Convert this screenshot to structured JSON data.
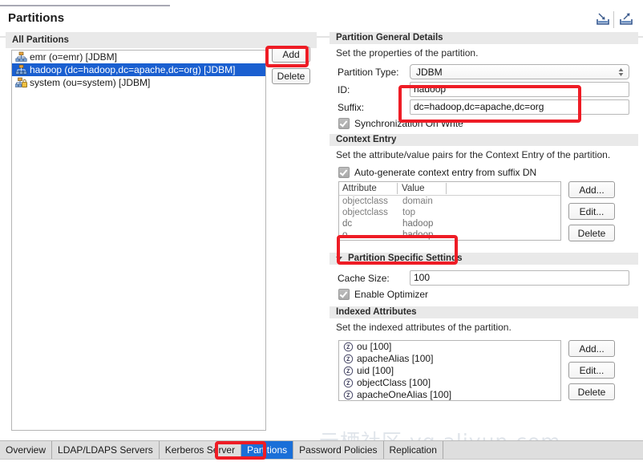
{
  "window": {
    "title": "Partitions",
    "restore_icon": "restore-window-icon",
    "maximize_icon": "maximize-window-icon"
  },
  "left": {
    "section_title": "All Partitions",
    "partitions": [
      {
        "icon": "partition-tree-icon",
        "label": "emr (o=emr) [JDBM]",
        "selected": false
      },
      {
        "icon": "partition-tree-icon",
        "label": "hadoop (dc=hadoop,dc=apache,dc=org) [JDBM]",
        "selected": true
      },
      {
        "icon": "partition-tree-locked-icon",
        "label": "system (ou=system) [JDBM]",
        "selected": false
      }
    ],
    "add_label": "Add",
    "delete_label": "Delete"
  },
  "general": {
    "header": "Partition General Details",
    "description": "Set the properties of the partition.",
    "partition_type_label": "Partition Type:",
    "partition_type_value": "JDBM",
    "partition_type_options": [
      "JDBM"
    ],
    "id_label": "ID:",
    "id_value": "hadoop",
    "id_placeholder": "",
    "suffix_label": "Suffix:",
    "suffix_value": "dc=hadoop,dc=apache,dc=org",
    "suffix_placeholder": "",
    "sync_on_write_label": "Synchronization On Write",
    "sync_on_write_checked": true
  },
  "context_entry": {
    "header": "Context Entry",
    "description": "Set the attribute/value pairs for the Context Entry of the partition.",
    "autogen_label": "Auto-generate context entry from suffix DN",
    "autogen_checked": true,
    "columns": [
      "Attribute",
      "Value"
    ],
    "rows": [
      {
        "attribute": "objectclass",
        "value": "domain"
      },
      {
        "attribute": "objectclass",
        "value": "top"
      },
      {
        "attribute": "dc",
        "value": "hadoop"
      },
      {
        "attribute": "o",
        "value": "hadoop"
      }
    ],
    "add_label": "Add...",
    "edit_label": "Edit...",
    "delete_label": "Delete"
  },
  "specific": {
    "header": "Partition Specific Settings",
    "expanded": true,
    "cache_size_label": "Cache Size:",
    "cache_size_value": "100",
    "enable_optimizer_label": "Enable Optimizer",
    "enable_optimizer_checked": true
  },
  "indexed": {
    "header": "Indexed Attributes",
    "description": "Set the indexed attributes of the partition.",
    "items": [
      "ou [100]",
      "apacheAlias [100]",
      "uid [100]",
      "objectClass [100]",
      "apacheOneAlias [100]"
    ],
    "add_label": "Add...",
    "edit_label": "Edit...",
    "delete_label": "Delete"
  },
  "tabs": [
    {
      "label": "Overview",
      "active": false
    },
    {
      "label": "LDAP/LDAPS Servers",
      "active": false
    },
    {
      "label": "Kerberos Server",
      "active": false
    },
    {
      "label": "Partitions",
      "active": true
    },
    {
      "label": "Password Policies",
      "active": false
    },
    {
      "label": "Replication",
      "active": false
    }
  ],
  "watermark": "云栖社区 yq.aliyun.com",
  "colors": {
    "accent_selection": "#1a5fd0",
    "tab_active": "#1a6fd8",
    "annotation": "#ee1c25",
    "section_header_bg": "#e9e9e9"
  }
}
